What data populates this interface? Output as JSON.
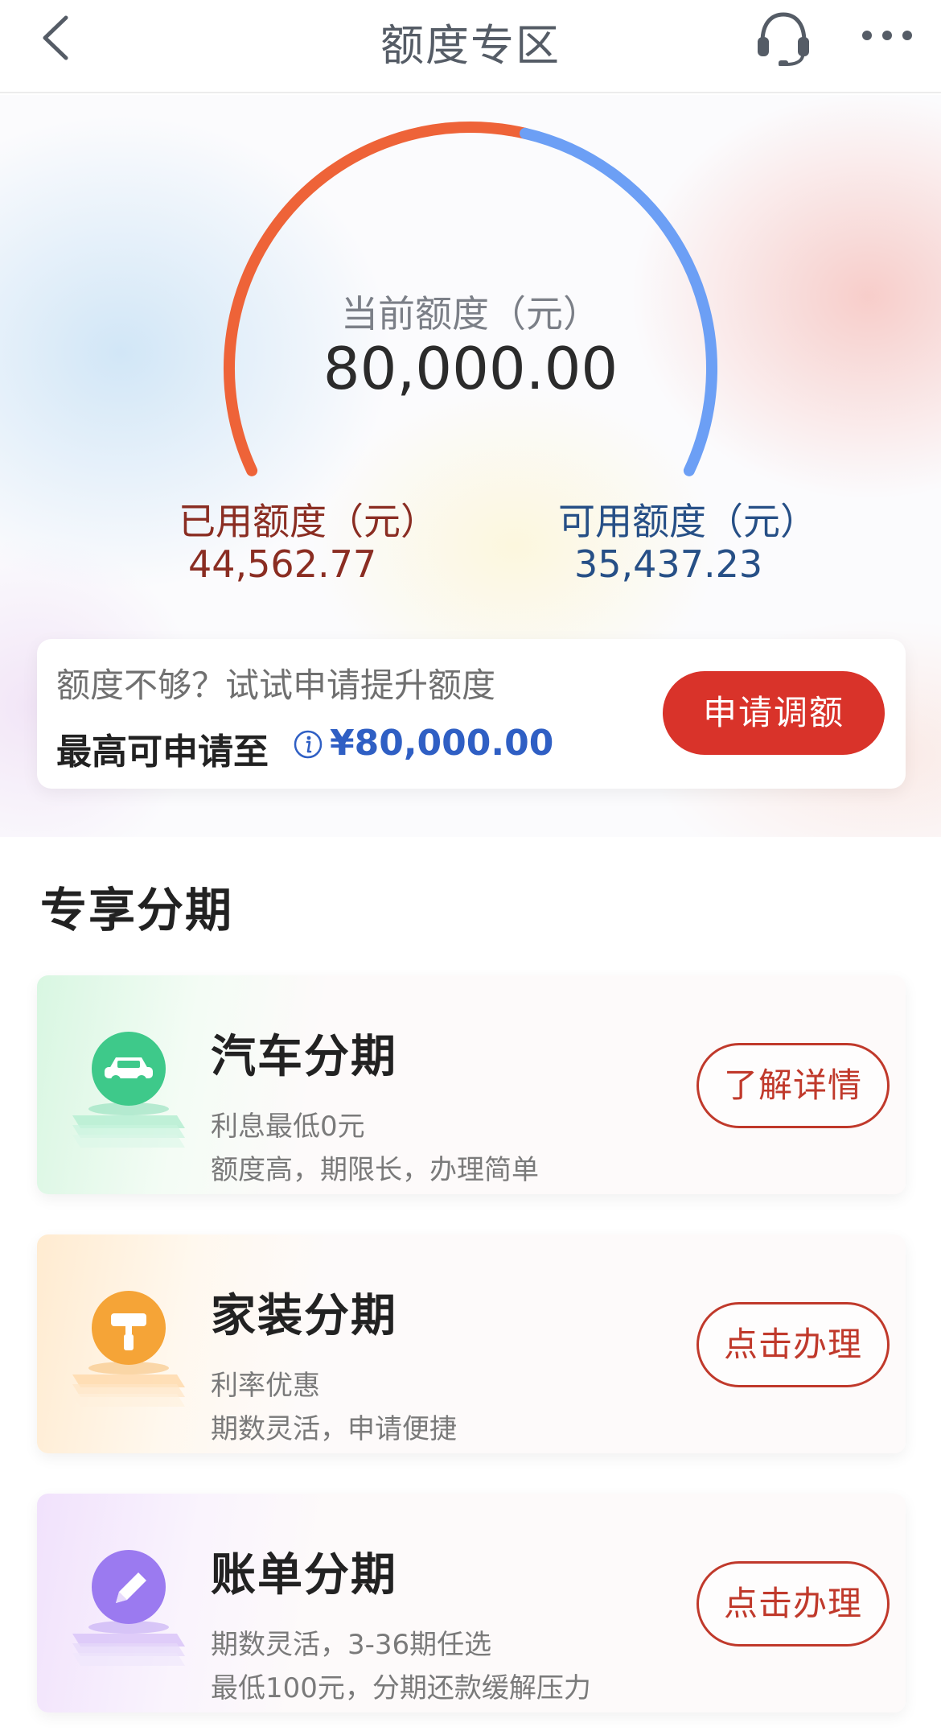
{
  "header": {
    "title": "额度专区",
    "back_icon": "chevron-left-icon",
    "service_icon": "headset-icon",
    "more_icon": "more-dots-icon"
  },
  "gauge": {
    "label": "当前额度（元）",
    "value": "80,000.00",
    "used_fraction": 0.557,
    "used_color": "#ee6338",
    "available_color": "#6c9ff5"
  },
  "used": {
    "label": "已用额度（元）",
    "value": "44,562.77"
  },
  "available": {
    "label": "可用额度（元）",
    "value": "35,437.23"
  },
  "apply": {
    "prompt": "额度不够？试试申请提升额度",
    "max_label": "最高可申请至",
    "max_value": "¥80,000.00",
    "button": "申请调额"
  },
  "section": {
    "title": "专享分期"
  },
  "products": [
    {
      "name": "汽车分期",
      "desc1": "利息最低0元",
      "desc2": "额度高，期限长，办理简单",
      "button": "了解详情",
      "icon": "car-icon",
      "color": "#3ec98a"
    },
    {
      "name": "家装分期",
      "desc1": "利率优惠",
      "desc2": "期数灵活，申请便捷",
      "button": "点击办理",
      "icon": "paint-roller-icon",
      "color": "#f5a437"
    },
    {
      "name": "账单分期",
      "desc1": "期数灵活，3-36期任选",
      "desc2": "最低100元，分期还款缓解压力",
      "button": "点击办理",
      "icon": "pencil-icon",
      "color": "#9b7af0"
    }
  ]
}
